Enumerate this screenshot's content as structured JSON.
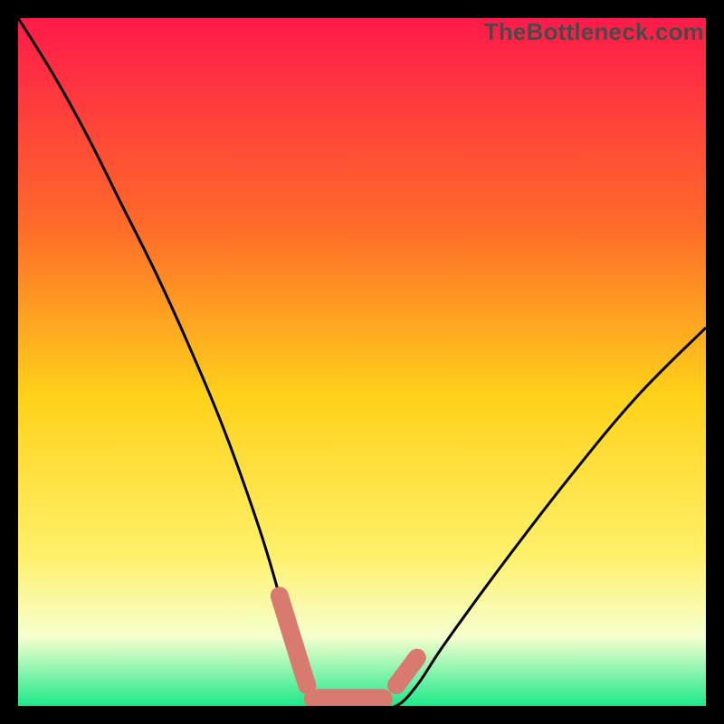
{
  "watermark": "TheBottleneck.com",
  "colors": {
    "frame": "#000000",
    "gradient_top": "#ff1a4a",
    "gradient_mid1": "#ff6a2a",
    "gradient_mid2": "#ffd21a",
    "gradient_mid3": "#fff06a",
    "gradient_mid4": "#f5ffcf",
    "gradient_bottom": "#1ee88a",
    "curve": "#000000",
    "marker_fill": "#d87a6f",
    "marker_stroke": "#c86a60"
  },
  "chart_data": {
    "type": "line",
    "title": "",
    "xlabel": "",
    "ylabel": "",
    "x": [
      0,
      5,
      10,
      15,
      20,
      25,
      30,
      35,
      38,
      40,
      42,
      45,
      48,
      50,
      52,
      55,
      58,
      62,
      70,
      80,
      90,
      100
    ],
    "values": [
      100,
      92,
      83,
      73,
      63,
      52,
      40,
      26,
      16,
      8,
      3,
      0,
      0,
      0,
      0,
      0,
      3,
      9,
      20,
      33,
      45,
      55
    ],
    "ylim": [
      0,
      100
    ],
    "xlim": [
      0,
      100
    ],
    "markers": {
      "segments": [
        {
          "x0": 38,
          "y0": 16,
          "x1": 42,
          "y1": 3
        },
        {
          "x0": 43,
          "y0": 1,
          "x1": 53,
          "y1": 1
        },
        {
          "x0": 55,
          "y0": 3,
          "x1": 58,
          "y1": 7
        }
      ],
      "style": "rounded-rect"
    }
  }
}
